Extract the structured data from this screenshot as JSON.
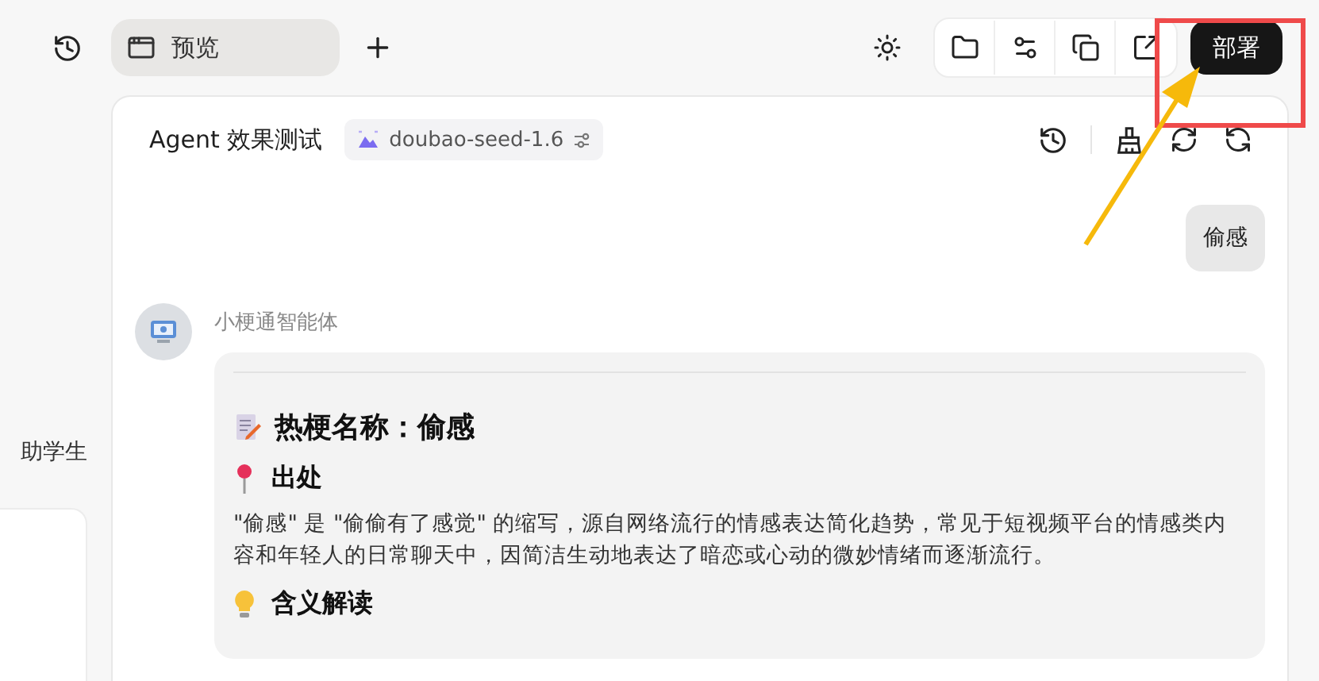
{
  "top_bar": {
    "tab": {
      "label": "预览",
      "selected": true
    },
    "deploy_button": "部署"
  },
  "sidebar": {
    "text": "助学生"
  },
  "panel": {
    "title": "Agent 效果测试",
    "model": "doubao-seed-1.6"
  },
  "messages": [
    {
      "kind": "user",
      "text": "偷感"
    },
    {
      "kind": "bot",
      "sender": "小梗通智能体",
      "title": "热梗名称：偷感",
      "sections": [
        {
          "heading": "出处",
          "body": "\"偷感\" 是 \"偷偷有了感觉\" 的缩写，源自网络流行的情感表达简化趋势，常见于短视频平台的情感类内容和年轻人的日常聊天中，因简洁生动地表达了暗恋或心动的微妙情绪而逐渐流行。"
        },
        {
          "heading": "含义解读"
        }
      ]
    }
  ]
}
